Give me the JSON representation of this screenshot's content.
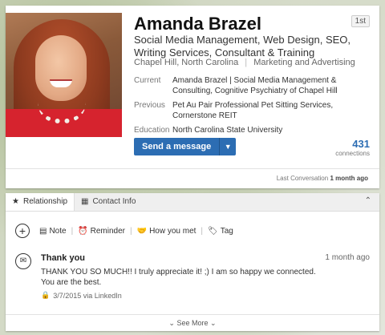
{
  "profile": {
    "name": "Amanda Brazel",
    "degree": "1st",
    "headline": "Social Media Management, Web Design, SEO, Writing Services, Consultant & Training",
    "location": "Chapel Hill, North Carolina",
    "industry": "Marketing and Advertising",
    "current_label": "Current",
    "current_value": "Amanda Brazel | Social Media Management & Consulting, Cognitive Psychiatry of Chapel Hill",
    "previous_label": "Previous",
    "previous_value": "Pet Au Pair Professional Pet Sitting Services, Cornerstone REIT",
    "education_label": "Education",
    "education_value": "North Carolina State University",
    "send_message_label": "Send a message",
    "connections_count": "431",
    "connections_label": "connections",
    "last_conversation_label": "Last Conversation",
    "last_conversation_value": "1 month ago"
  },
  "relationship": {
    "tab_relationship": "Relationship",
    "tab_contact_info": "Contact Info",
    "actions": {
      "note": "Note",
      "reminder": "Reminder",
      "how_you_met": "How you met",
      "tag": "Tag"
    },
    "message": {
      "title": "Thank you",
      "date": "1 month ago",
      "body": "THANK YOU SO MUCH!! I truly appreciate it! ;) I am so happy we connected. You are the best.",
      "via": "3/7/2015 via LinkedIn"
    },
    "see_more_label": "See More"
  },
  "colors": {
    "accent": "#2c6db3",
    "dress": "#d6232e"
  },
  "icons": [
    "plus-icon",
    "note-icon",
    "alarm-icon",
    "handshake-icon",
    "tag-icon",
    "envelope-icon",
    "lock-icon",
    "chevron-down-icon",
    "collapse-icon",
    "star-icon",
    "contact-card-icon"
  ]
}
